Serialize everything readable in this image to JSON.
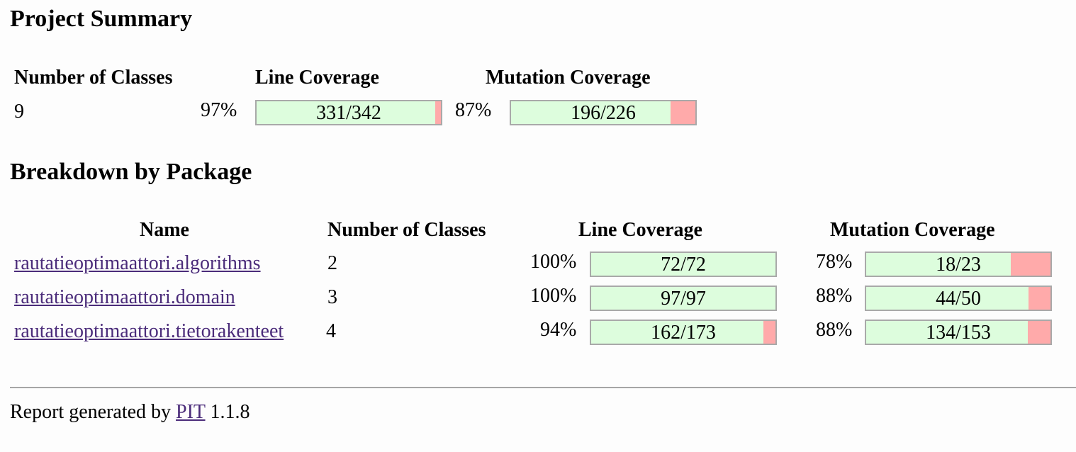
{
  "summary": {
    "title": "Project Summary",
    "headers": {
      "classes": "Number of Classes",
      "line": "Line Coverage",
      "mutation": "Mutation Coverage"
    },
    "classes": "9",
    "line_pct": "97%",
    "line_ratio": "331/342",
    "line_fraction": 0.968,
    "mutation_pct": "87%",
    "mutation_ratio": "196/226",
    "mutation_fraction": 0.867
  },
  "breakdown": {
    "title": "Breakdown by Package",
    "headers": {
      "name": "Name",
      "classes": "Number of Classes",
      "line": "Line Coverage",
      "mutation": "Mutation Coverage"
    },
    "rows": [
      {
        "name": "rautatieoptimaattori.algorithms",
        "classes": "2",
        "line_pct": "100%",
        "line_ratio": "72/72",
        "line_fraction": 1.0,
        "mutation_pct": "78%",
        "mutation_ratio": "18/23",
        "mutation_fraction": 0.783
      },
      {
        "name": "rautatieoptimaattori.domain",
        "classes": "3",
        "line_pct": "100%",
        "line_ratio": "97/97",
        "line_fraction": 1.0,
        "mutation_pct": "88%",
        "mutation_ratio": "44/50",
        "mutation_fraction": 0.88
      },
      {
        "name": "rautatieoptimaattori.tietorakenteet",
        "classes": "4",
        "line_pct": "94%",
        "line_ratio": "162/173",
        "line_fraction": 0.936,
        "mutation_pct": "88%",
        "mutation_ratio": "134/153",
        "mutation_fraction": 0.876
      }
    ]
  },
  "footer": {
    "prefix": "Report generated by",
    "link": "PIT",
    "version": "1.1.8"
  },
  "colors": {
    "covered": "#ddfddd",
    "uncovered": "#ffaaaa",
    "link": "#4b2c7a"
  }
}
